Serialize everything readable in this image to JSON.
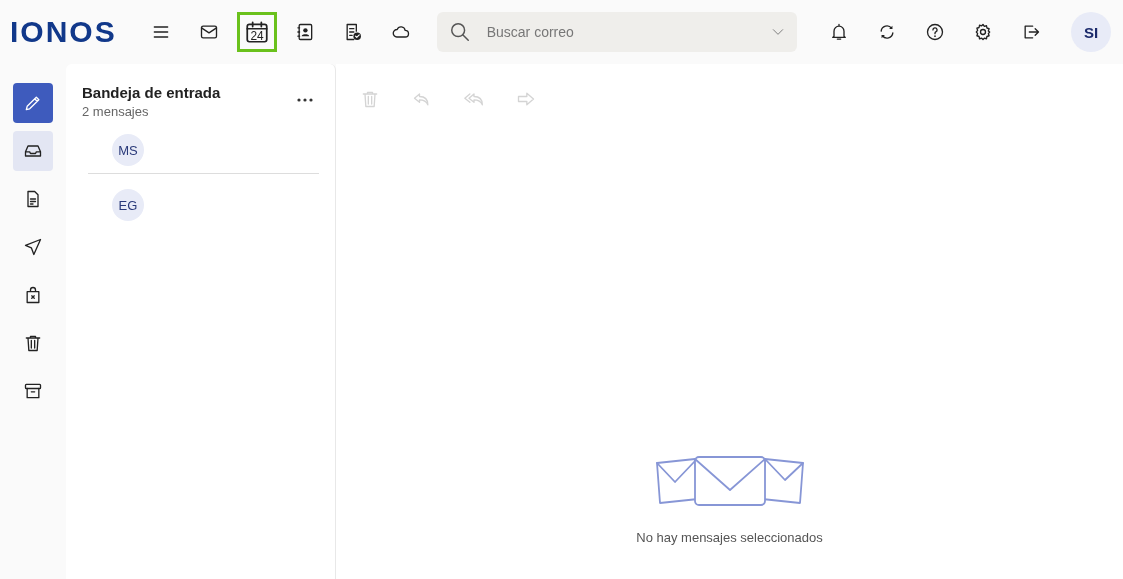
{
  "header": {
    "logo": "IONOS",
    "apps": [
      {
        "kind": "menu",
        "selected": false
      },
      {
        "kind": "mail",
        "selected": false
      },
      {
        "kind": "calendar",
        "label": "24",
        "selected": true
      },
      {
        "kind": "contacts",
        "selected": false
      },
      {
        "kind": "tasks",
        "selected": false
      },
      {
        "kind": "cloud",
        "selected": false
      }
    ],
    "search": {
      "placeholder": "Buscar correo"
    },
    "actions": [
      {
        "kind": "bell"
      },
      {
        "kind": "sync"
      },
      {
        "kind": "help"
      },
      {
        "kind": "settings"
      },
      {
        "kind": "logout"
      }
    ],
    "avatar": "SI"
  },
  "sidebar": {
    "compose": {
      "kind": "compose"
    },
    "items": [
      {
        "kind": "inbox",
        "selected": true
      },
      {
        "kind": "drafts",
        "selected": false
      },
      {
        "kind": "sent",
        "selected": false
      },
      {
        "kind": "spam",
        "selected": false
      },
      {
        "kind": "trash",
        "selected": false
      },
      {
        "kind": "archive",
        "selected": false
      }
    ]
  },
  "message_list": {
    "title": "Bandeja de entrada",
    "count": "2 mensajes",
    "messages": [
      {
        "initials": "MS"
      },
      {
        "initials": "EG"
      }
    ]
  },
  "reader": {
    "toolbar": [
      {
        "kind": "delete",
        "disabled": true
      },
      {
        "kind": "reply",
        "disabled": true
      },
      {
        "kind": "reply_all",
        "disabled": true
      },
      {
        "kind": "forward",
        "disabled": true
      }
    ],
    "empty_text": "No hay mensajes seleccionados"
  }
}
